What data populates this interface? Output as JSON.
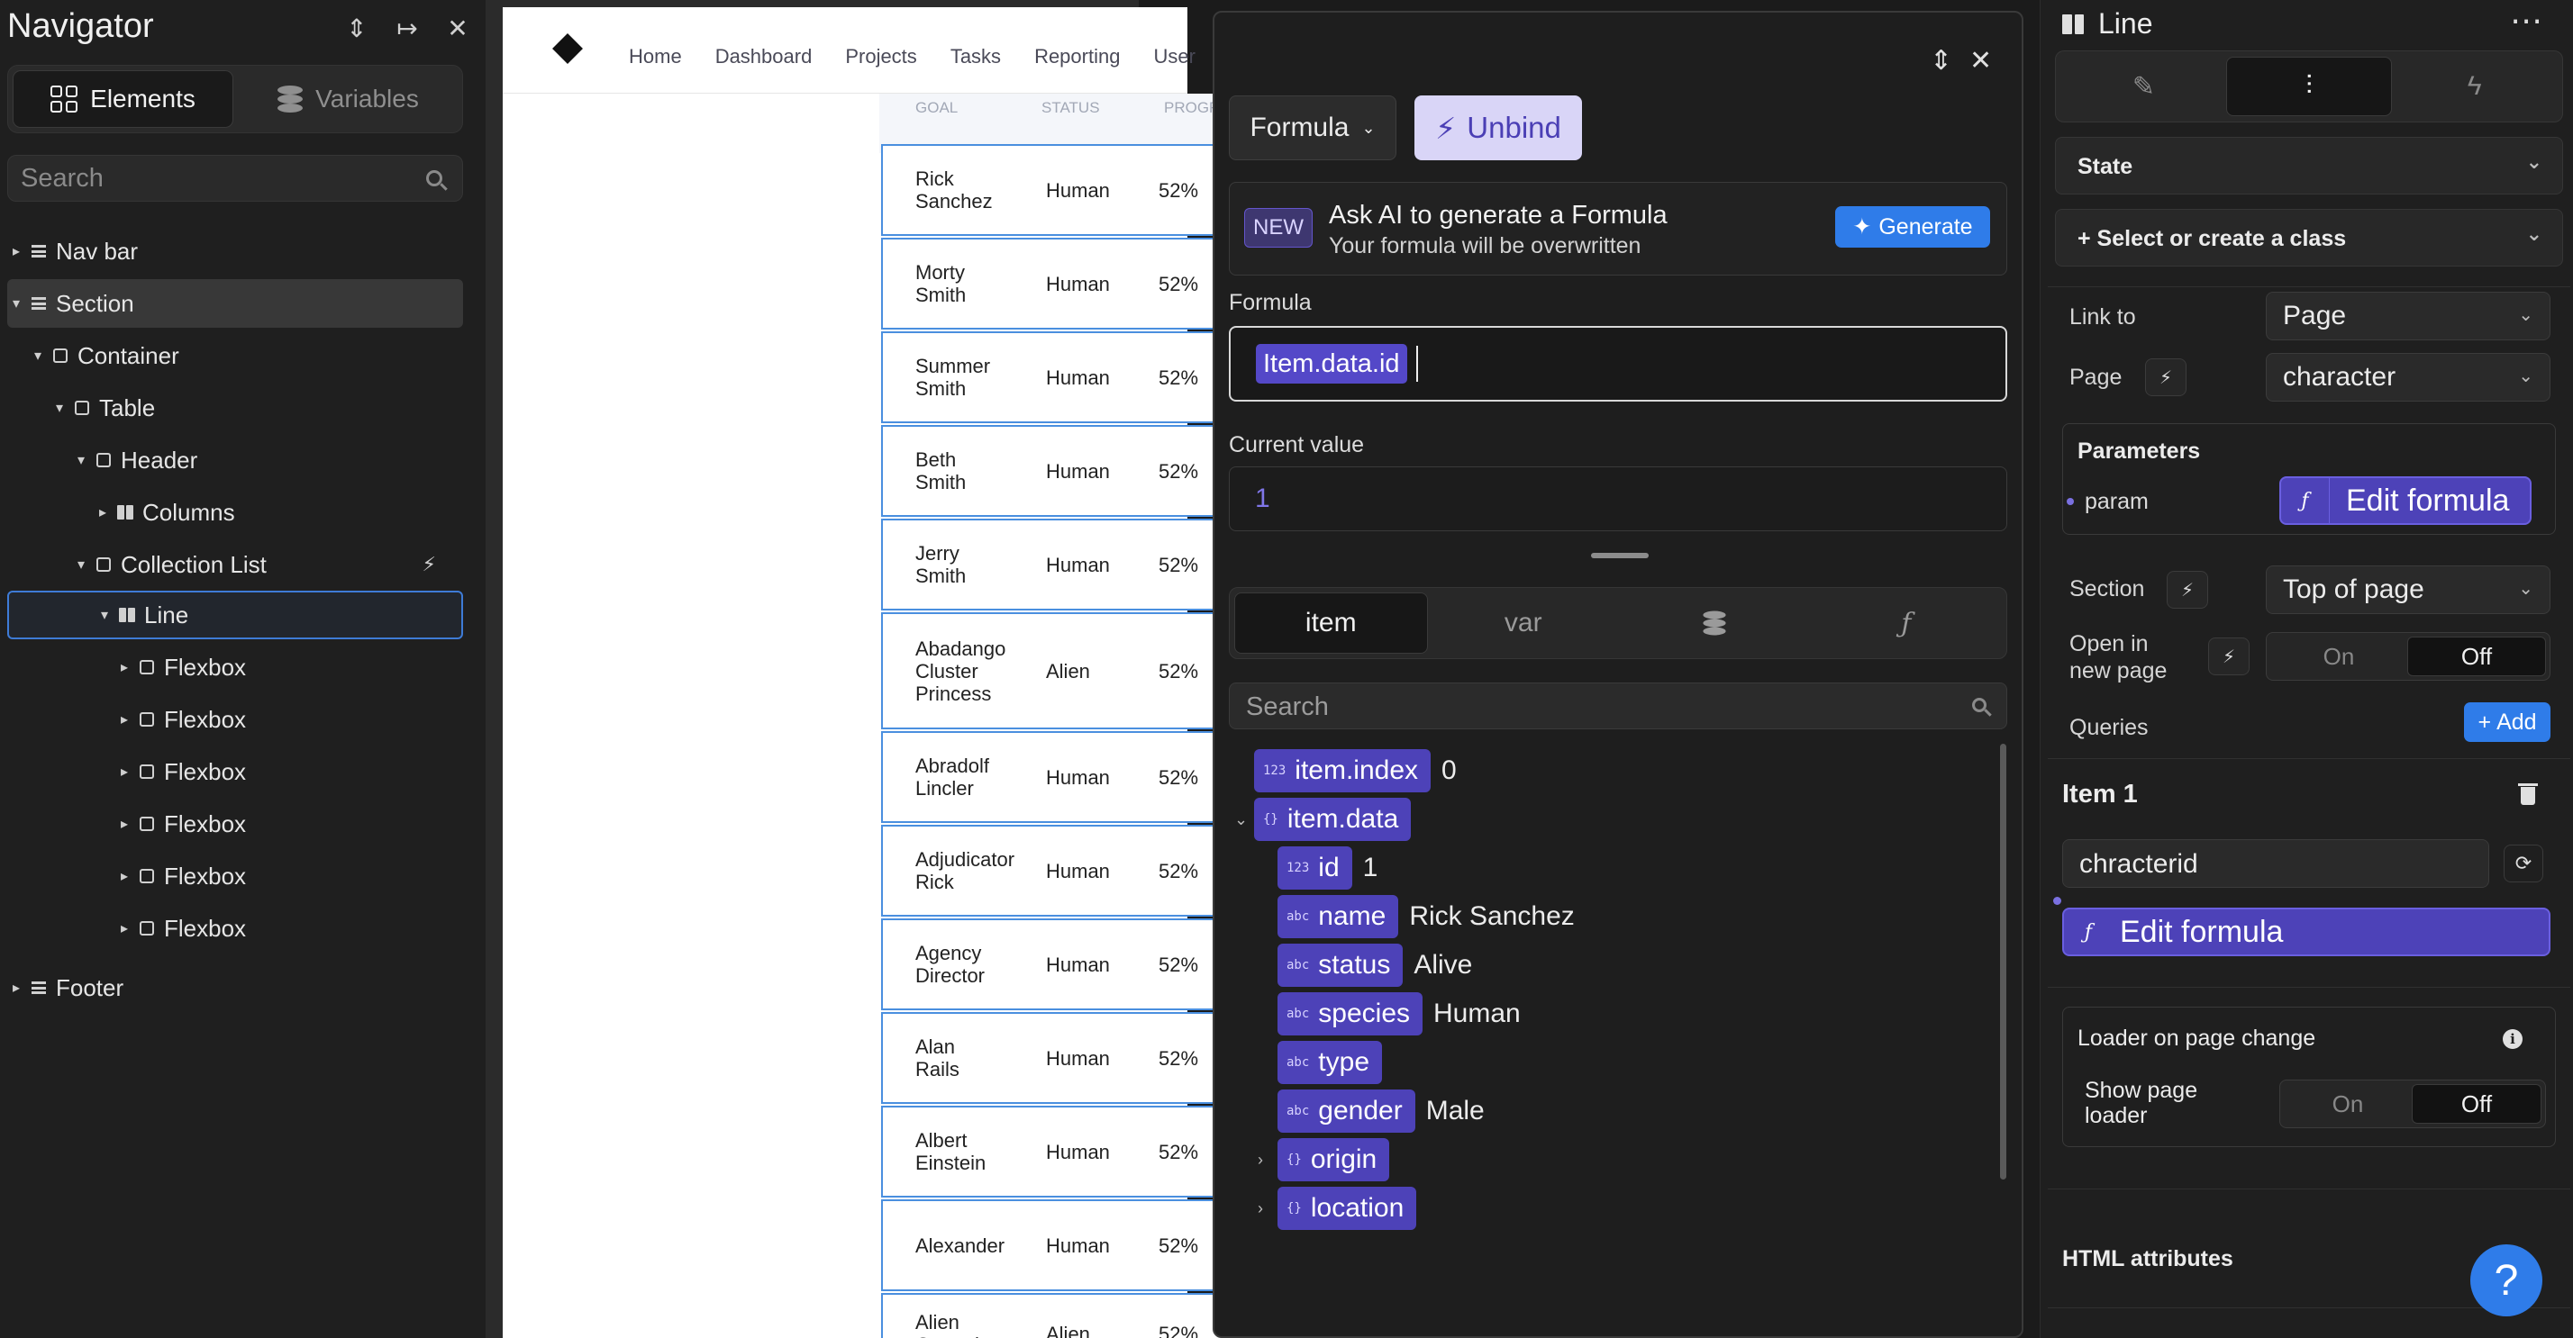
{
  "navigator": {
    "title": "Navigator",
    "tabs": {
      "elements": "Elements",
      "variables": "Variables"
    },
    "search_placeholder": "Search",
    "tree": [
      {
        "label": "Nav bar"
      },
      {
        "label": "Section"
      },
      {
        "label": "Container"
      },
      {
        "label": "Table"
      },
      {
        "label": "Header"
      },
      {
        "label": "Columns"
      },
      {
        "label": "Collection List"
      },
      {
        "label": "Line"
      },
      {
        "label": "Flexbox"
      },
      {
        "label": "Flexbox"
      },
      {
        "label": "Flexbox"
      },
      {
        "label": "Flexbox"
      },
      {
        "label": "Flexbox"
      },
      {
        "label": "Flexbox"
      },
      {
        "label": "Footer"
      }
    ]
  },
  "canvas": {
    "nav_links": [
      "Home",
      "Dashboard",
      "Projects",
      "Tasks",
      "Reporting",
      "User"
    ],
    "columns": [
      "GOAL",
      "STATUS",
      "PROGR"
    ],
    "rows": [
      {
        "name": "Rick\nSanchez",
        "species": "Human",
        "progress": "52%"
      },
      {
        "name": "Morty\nSmith",
        "species": "Human",
        "progress": "52%"
      },
      {
        "name": "Summer\nSmith",
        "species": "Human",
        "progress": "52%"
      },
      {
        "name": "Beth\nSmith",
        "species": "Human",
        "progress": "52%"
      },
      {
        "name": "Jerry\nSmith",
        "species": "Human",
        "progress": "52%"
      },
      {
        "name": "Abadango\nCluster\nPrincess",
        "species": "Alien",
        "progress": "52%"
      },
      {
        "name": "Abradolf\nLincler",
        "species": "Human",
        "progress": "52%"
      },
      {
        "name": "Adjudicator\nRick",
        "species": "Human",
        "progress": "52%"
      },
      {
        "name": "Agency\nDirector",
        "species": "Human",
        "progress": "52%"
      },
      {
        "name": "Alan\nRails",
        "species": "Human",
        "progress": "52%"
      },
      {
        "name": "Albert\nEinstein",
        "species": "Human",
        "progress": "52%"
      },
      {
        "name": "Alexander",
        "species": "Human",
        "progress": "52%"
      },
      {
        "name": "Alien\nGoogah",
        "species": "Alien",
        "progress": "52%"
      }
    ]
  },
  "popup": {
    "formula_dropdown": "Formula",
    "unbind": "Unbind",
    "ai": {
      "badge": "NEW",
      "title": "Ask AI to generate a Formula",
      "subtitle": "Your formula will be overwritten",
      "generate": "Generate"
    },
    "formula_label": "Formula",
    "formula_token": "Item.data.id",
    "current_value_label": "Current value",
    "current_value": "1",
    "tabs": {
      "item": "item",
      "var": "var"
    },
    "search_placeholder": "Search",
    "vars": [
      {
        "type": "123",
        "name": "item.index",
        "value": "0"
      },
      {
        "type": "{}",
        "name": "item.data",
        "value": ""
      },
      {
        "type": "123",
        "name": "id",
        "value": "1"
      },
      {
        "type": "abc",
        "name": "name",
        "value": "Rick Sanchez"
      },
      {
        "type": "abc",
        "name": "status",
        "value": "Alive"
      },
      {
        "type": "abc",
        "name": "species",
        "value": "Human"
      },
      {
        "type": "abc",
        "name": "type",
        "value": ""
      },
      {
        "type": "abc",
        "name": "gender",
        "value": "Male"
      },
      {
        "type": "{}",
        "name": "origin",
        "value": ""
      },
      {
        "type": "{}",
        "name": "location",
        "value": ""
      }
    ]
  },
  "right": {
    "title": "Line",
    "state": "State",
    "class_select": "Select or create a class",
    "link_to_label": "Link to",
    "link_to_value": "Page",
    "page_label": "Page",
    "page_value": "character",
    "parameters_label": "Parameters",
    "param_name": "param",
    "edit_formula": "Edit formula",
    "section_label": "Section",
    "section_value": "Top of page",
    "open_new_label": "Open in\nnew page",
    "on": "On",
    "off": "Off",
    "queries_label": "Queries",
    "add": "Add",
    "item_title": "Item 1",
    "query_key": "chracterid",
    "loader_label": "Loader on page change",
    "show_loader_label": "Show page\nloader",
    "html_attrs": "HTML attributes",
    "help": "?"
  }
}
